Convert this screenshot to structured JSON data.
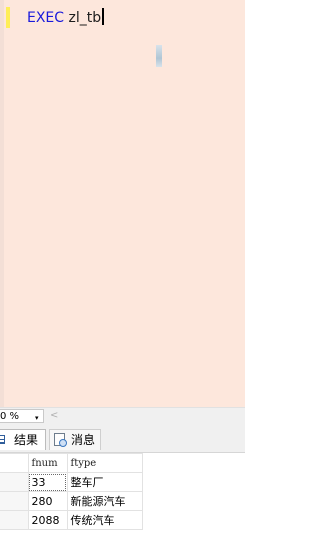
{
  "editor": {
    "keyword": "EXEC",
    "identifier": "zl_tb"
  },
  "zoom": {
    "value": "0 %",
    "arrow": "▾",
    "scroll_left": "<"
  },
  "tabs": [
    {
      "label": "结果",
      "icon": "grid-icon"
    },
    {
      "label": "消息",
      "icon": "messages-icon"
    }
  ],
  "results": {
    "columns": [
      "fnum",
      "ftype"
    ],
    "rows": [
      {
        "fnum": "33",
        "ftype": "整车厂"
      },
      {
        "fnum": "280",
        "ftype": "新能源汽车"
      },
      {
        "fnum": "2088",
        "ftype": "传统汽车"
      }
    ]
  },
  "colors": {
    "editor_background": "#fde7dc",
    "keyword": "#1a1adb",
    "change_bar": "#ffee58"
  }
}
